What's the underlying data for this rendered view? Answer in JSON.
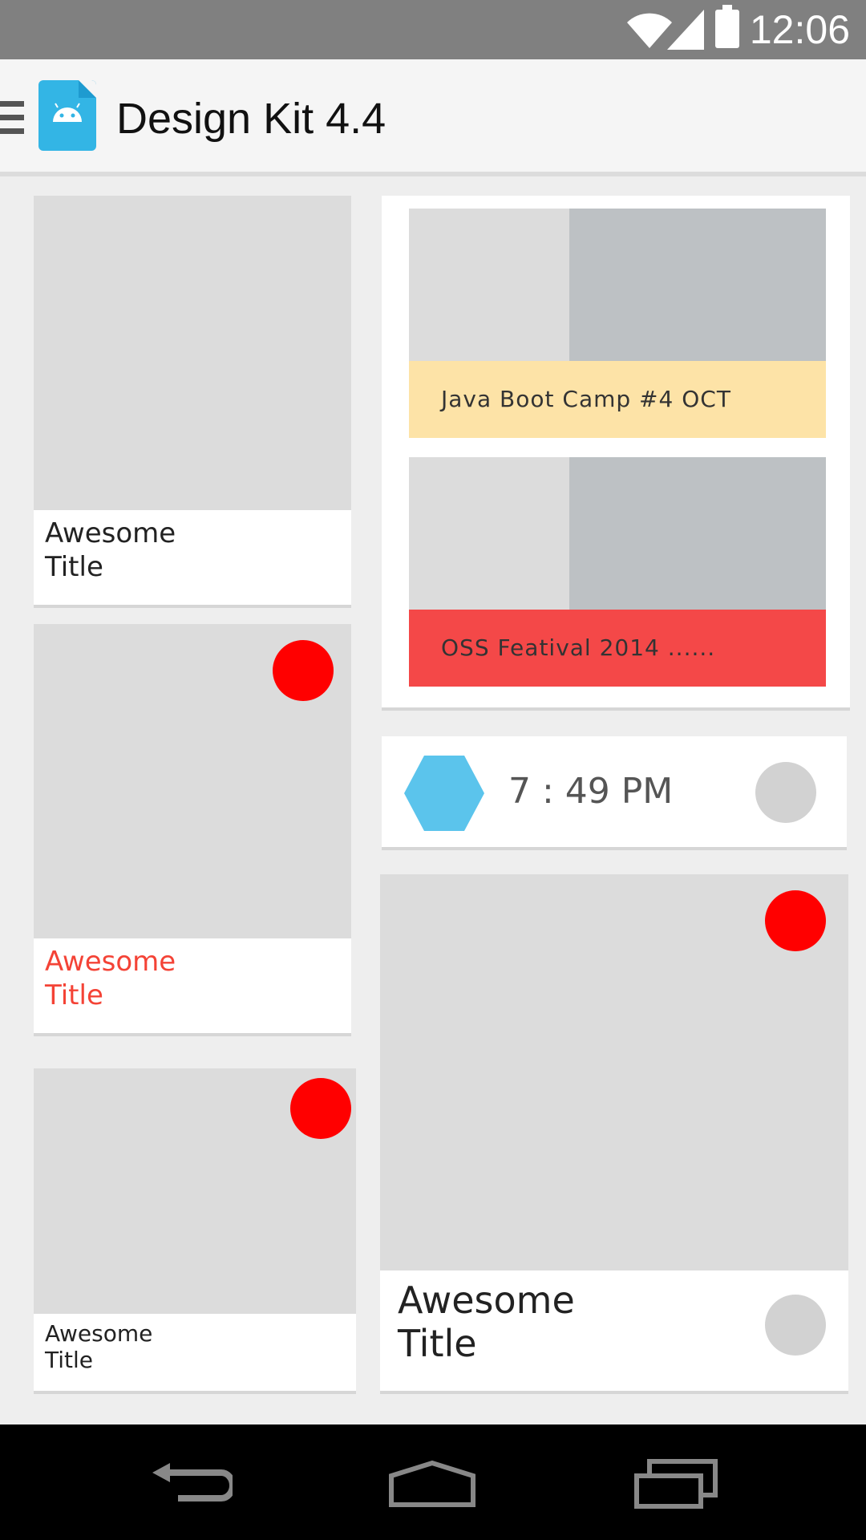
{
  "status_bar": {
    "time": "12:06",
    "icons": [
      "wifi-icon",
      "signal-icon",
      "battery-icon"
    ]
  },
  "app_bar": {
    "title": "Design Kit 4.4",
    "menu_icon": "menu-icon",
    "app_icon": "android-icon"
  },
  "cards": {
    "left1": {
      "title": "Awesome\nTitle",
      "title_color": "#222222"
    },
    "left2": {
      "title": "Awesome\nTitle",
      "title_color": "#f44336"
    },
    "left3": {
      "title": "Awesome\nTitle",
      "title_color": "#222222"
    },
    "events": [
      {
        "label": "Java Boot Camp #4 OCT",
        "color": "#fde3a7"
      },
      {
        "label": "OSS Featival 2014 ......",
        "color": "#f44848"
      }
    ],
    "time_card": {
      "time": "7 : 49  PM",
      "hex_color": "#5bc4ec"
    },
    "large": {
      "title": "Awesome\nTitle"
    }
  },
  "colors": {
    "accent_red": "#ff0000",
    "blue": "#33b5e5"
  },
  "nav_bar": {
    "icons": [
      "back-icon",
      "home-icon",
      "recents-icon"
    ]
  }
}
